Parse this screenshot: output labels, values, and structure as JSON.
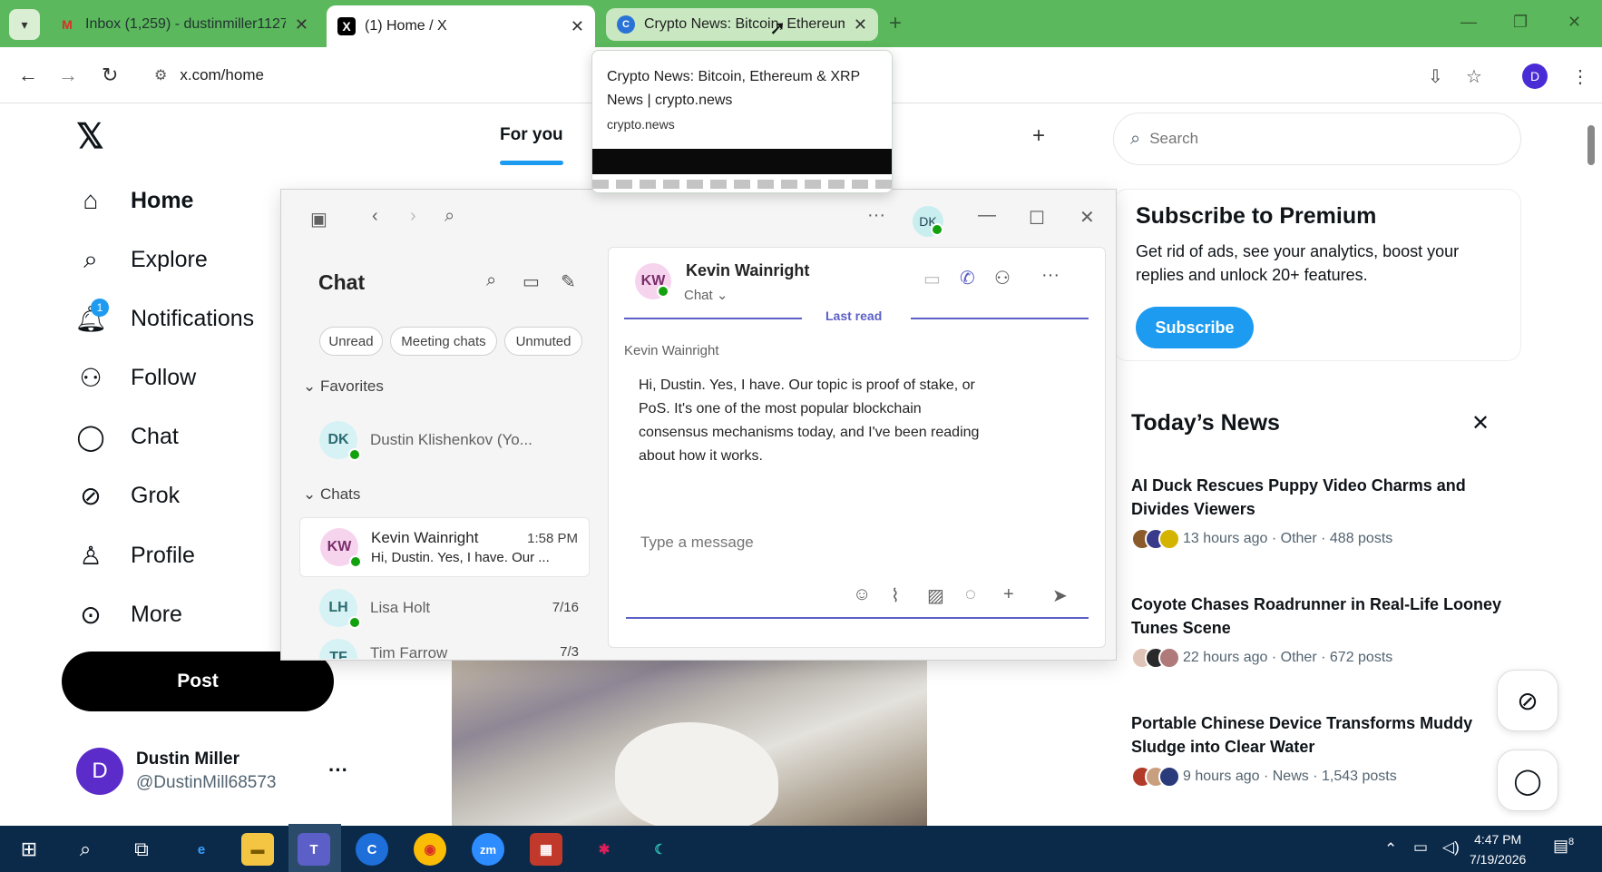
{
  "browser": {
    "tabs": [
      {
        "title": "Inbox (1,259) - dustinmiller1127",
        "favicon": "gmail-icon"
      },
      {
        "title": "(1) Home / X",
        "favicon": "x-icon"
      },
      {
        "title": "Crypto News: Bitcoin, Ethereum",
        "favicon": "crypto-news-icon"
      }
    ],
    "url": "x.com/home",
    "profile_initial": "D"
  },
  "hover_card": {
    "title": "Crypto News: Bitcoin, Ethereum & XRP News | crypto.news",
    "domain": "crypto.news"
  },
  "x": {
    "nav": [
      {
        "label": "Home",
        "icon": "home-icon"
      },
      {
        "label": "Explore",
        "icon": "search-icon"
      },
      {
        "label": "Notifications",
        "icon": "bell-icon",
        "badge": "1"
      },
      {
        "label": "Follow",
        "icon": "add-person-icon"
      },
      {
        "label": "Chat",
        "icon": "chat-bubble-icon"
      },
      {
        "label": "Grok",
        "icon": "grok-icon"
      },
      {
        "label": "Profile",
        "icon": "person-icon"
      },
      {
        "label": "More",
        "icon": "more-circle-icon"
      }
    ],
    "post_label": "Post",
    "account": {
      "initial": "D",
      "name": "Dustin Miller",
      "handle": "@DustinMill68573",
      "more": "···"
    },
    "feed_tab": "For you",
    "search_placeholder": "Search",
    "premium": {
      "title": "Subscribe to Premium",
      "text": "Get rid of ads, see your analytics, boost your replies and unlock 20+ features.",
      "button": "Subscribe"
    },
    "news": {
      "title": "Today’s News",
      "items": [
        {
          "headline": "AI Duck Rescues Puppy Video Charms and Divides Viewers",
          "time": "13 hours ago",
          "category": "Other",
          "posts": "488 posts"
        },
        {
          "headline": "Coyote Chases Roadrunner in Real-Life Looney Tunes Scene",
          "time": "22 hours ago",
          "category": "Other",
          "posts": "672 posts"
        },
        {
          "headline": "Portable Chinese Device Transforms Muddy Sludge into Clear Water",
          "time": "9 hours ago",
          "category": "News",
          "posts": "1,543 posts"
        }
      ],
      "sep": "·"
    }
  },
  "teams": {
    "user_initials": "DK",
    "chat_title": "Chat",
    "filters": [
      "Unread",
      "Meeting chats",
      "Unmuted"
    ],
    "sections": {
      "favorites": "Favorites",
      "chats": "Chats"
    },
    "favorites": [
      {
        "initials": "DK",
        "name": "Dustin Klishenkov (Yo..."
      }
    ],
    "chats": [
      {
        "initials": "KW",
        "name": "Kevin Wainright",
        "time": "1:58 PM",
        "preview": "Hi, Dustin. Yes, I have. Our ..."
      },
      {
        "initials": "LH",
        "name": "Lisa Holt",
        "time": "7/16",
        "preview": ""
      },
      {
        "initials": "TF",
        "name": "Tim Farrow",
        "time": "7/3",
        "preview": ""
      }
    ],
    "conversation": {
      "initials": "KW",
      "name": "Kevin Wainright",
      "subtitle": "Chat",
      "last_read": "Last read",
      "sender": "Kevin Wainright",
      "message": "Hi, Dustin. Yes, I have. Our topic is proof of stake, or PoS. It's one of the most popular blockchain consensus mechanisms today, and I've been reading about how it works.",
      "composer_placeholder": "Type a message"
    }
  },
  "taskbar": {
    "time": "4:47 PM",
    "date": "7/19/2026",
    "notifications": "8"
  },
  "colors": {
    "x_blue": "#1d9bf0",
    "teams_purple": "#5b5fc7",
    "presence_green": "#13a10e",
    "browser_frame": "#5cb85c"
  }
}
